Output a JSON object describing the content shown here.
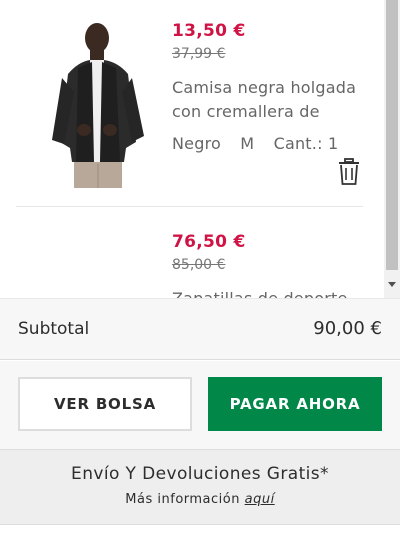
{
  "items": [
    {
      "price_now": "13,50 €",
      "price_old": "37,99 €",
      "title": "Camisa negra holgada con cremallera de satén",
      "color": "Negro",
      "size": "M",
      "quantity": "Cant.: 1"
    },
    {
      "price_now": "76,50 €",
      "price_old": "85,00 €",
      "title": "Zapatillas de deporte"
    }
  ],
  "summary": {
    "subtotal_label": "Subtotal",
    "subtotal_value": "90,00 €"
  },
  "actions": {
    "view_bag_label": "VER BOLSA",
    "pay_now_label": "PAGAR AHORA"
  },
  "shipping": {
    "title": "Envío Y Devoluciones Gratis*",
    "more_info": "Más información",
    "link": "aquí"
  },
  "icons": {
    "trash": "trash-icon",
    "scroll_down": "chevron-down-icon"
  },
  "colors": {
    "sale_price": "#d01345",
    "pay_button": "#018849"
  }
}
